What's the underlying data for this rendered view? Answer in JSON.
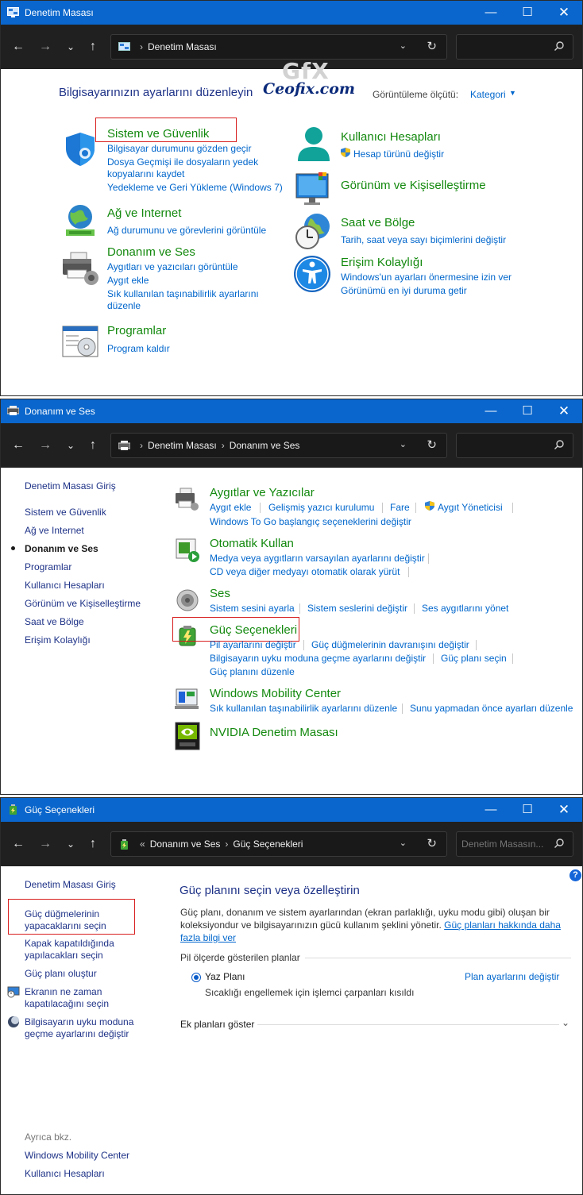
{
  "windows": [
    {
      "title": "Denetim Masası",
      "breadcrumb": [
        "Denetim Masası"
      ],
      "search_placeholder": "",
      "heading": "Bilgisayarınızın ayarlarını düzenleyin",
      "watermark": "Ceofix.com",
      "watermark_logo": "GfX",
      "view_by_label": "Görüntüleme ölçütü:",
      "view_by_value": "Kategori",
      "categories": [
        {
          "title": "Sistem ve Güvenlik",
          "icon": "shield-icon",
          "links": [
            "Bilgisayar durumunu gözden geçir",
            "Dosya Geçmişi ile dosyaların yedek",
            "kopyalarını kaydet",
            "Yedekleme ve Geri Yükleme (Windows 7)"
          ]
        },
        {
          "title": "Ağ ve Internet",
          "icon": "network-globe-icon",
          "links": [
            "Ağ durumunu ve görevlerini görüntüle"
          ]
        },
        {
          "title": "Donanım ve Ses",
          "icon": "printer-icon",
          "links": [
            "Aygıtları ve yazıcıları görüntüle",
            "Aygıt ekle",
            "Sık kullanılan taşınabilirlik ayarlarını",
            "düzenle"
          ]
        },
        {
          "title": "Programlar",
          "icon": "programs-icon",
          "links": [
            "Program kaldır"
          ]
        },
        {
          "title": "Kullanıcı Hesapları",
          "icon": "user-icon",
          "links": [
            "Hesap türünü değiştir"
          ]
        },
        {
          "title": "Görünüm ve Kişiselleştirme",
          "icon": "monitor-icon",
          "links": []
        },
        {
          "title": "Saat ve Bölge",
          "icon": "clock-globe-icon",
          "links": [
            "Tarih, saat veya sayı biçimlerini değiştir"
          ]
        },
        {
          "title": "Erişim Kolaylığı",
          "icon": "accessibility-icon",
          "links": [
            "Windows'un ayarları önermesine izin ver",
            "Görünümü en iyi duruma getir"
          ]
        }
      ]
    },
    {
      "title": "Donanım ve Ses",
      "breadcrumb": [
        "Denetim Masası",
        "Donanım ve Ses"
      ],
      "sidebar": [
        "Denetim Masası Giriş",
        "Sistem ve Güvenlik",
        "Ağ ve Internet",
        "Donanım ve Ses",
        "Programlar",
        "Kullanıcı Hesapları",
        "Görünüm ve Kişiselleştirme",
        "Saat ve Bölge",
        "Erişim Kolaylığı"
      ],
      "sections": [
        {
          "title": "Aygıtlar ve Yazıcılar",
          "links": [
            "Aygıt ekle",
            "Gelişmiş yazıcı kurulumu",
            "Fare",
            "Aygıt Yöneticisi",
            "Windows To Go başlangıç seçeneklerini değiştir"
          ]
        },
        {
          "title": "Otomatik Kullan",
          "links": [
            "Medya veya aygıtların varsayılan ayarlarını değiştir",
            "CD veya diğer medyayı otomatik olarak yürüt"
          ]
        },
        {
          "title": "Ses",
          "links": [
            "Sistem sesini ayarla",
            "Sistem seslerini değiştir",
            "Ses aygıtlarını yönet"
          ]
        },
        {
          "title": "Güç Seçenekleri",
          "links": [
            "Pil ayarlarını değiştir",
            "Güç düğmelerinin davranışını değiştir",
            "Bilgisayarın uyku moduna geçme ayarlarını değiştir",
            "Güç planı seçin",
            "Güç planını düzenle"
          ]
        },
        {
          "title": "Windows Mobility Center",
          "links": [
            "Sık kullanılan taşınabilirlik ayarlarını düzenle",
            "Sunu yapmadan önce ayarları düzenle"
          ]
        },
        {
          "title": "NVIDIA Denetim Masası",
          "links": []
        }
      ]
    },
    {
      "title": "Güç Seçenekleri",
      "breadcrumb_prefix": "«",
      "breadcrumb": [
        "Donanım ve Ses",
        "Güç Seçenekleri"
      ],
      "search_placeholder": "Denetim Masasın...",
      "sidebar": [
        "Denetim Masası Giriş",
        "Güç düğmelerinin",
        "yapacaklarını seçin",
        "Kapak kapatıldığında",
        "yapılacakları seçin",
        "Güç planı oluştur",
        "Ekranın ne zaman",
        "kapatılacağını seçin",
        "Bilgisayarın uyku moduna",
        "geçme ayarlarını değiştir"
      ],
      "see_also_label": "Ayrıca bkz.",
      "see_also": [
        "Windows Mobility Center",
        "Kullanıcı Hesapları"
      ],
      "heading": "Güç planını seçin veya özelleştirin",
      "description": "Güç planı, donanım ve sistem ayarlarından (ekran parlaklığı, uyku modu gibi) oluşan bir koleksiyondur ve bilgisayarınızın gücü kullanım şeklini yönetir.",
      "description_link": "Güç planları hakkında daha fazla bilgi ver",
      "plans_section": "Pil ölçerde gösterilen planlar",
      "plan_name": "Yaz Planı",
      "plan_settings_link": "Plan ayarlarını değiştir",
      "plan_description": "Sıcaklığı engellemek için işlemci çarpanları kısıldı",
      "extra_plans": "Ek planları göster",
      "help": "?"
    }
  ]
}
